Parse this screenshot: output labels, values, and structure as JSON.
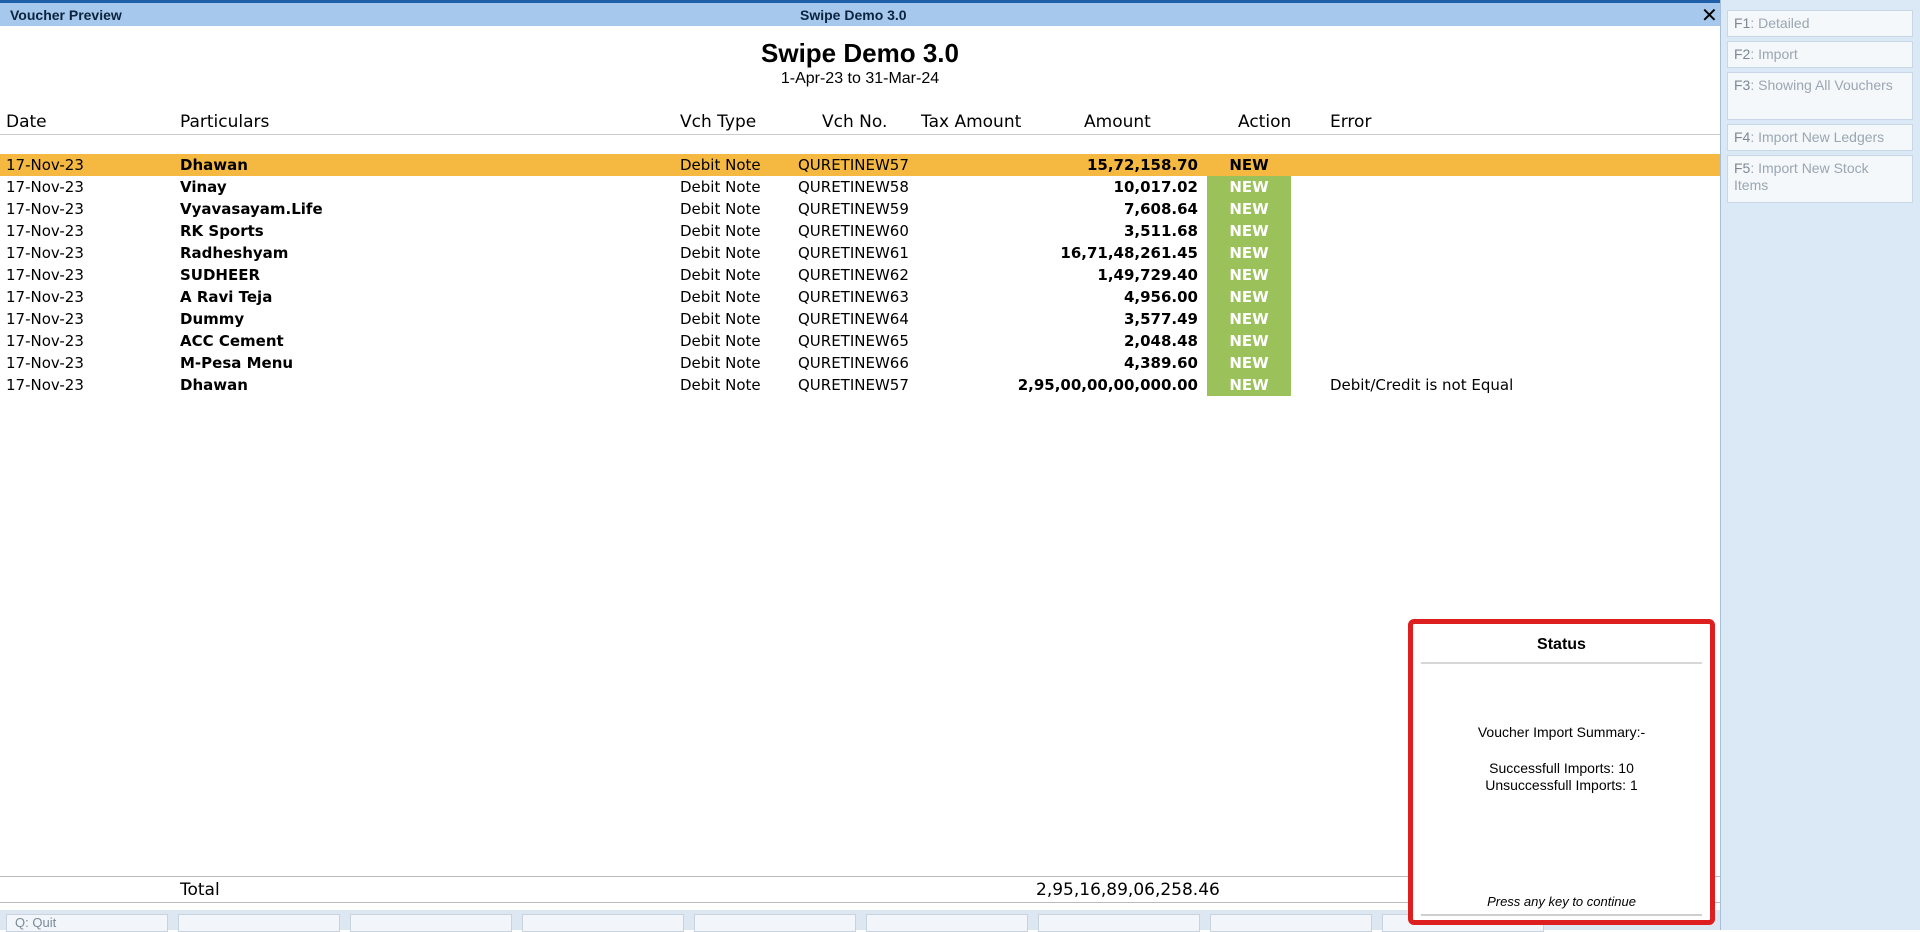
{
  "topbar": {
    "window_title": "Voucher Preview",
    "center_title": "Swipe Demo 3.0",
    "close": "✕"
  },
  "header": {
    "company": "Swipe Demo 3.0",
    "period": "1-Apr-23 to 31-Mar-24"
  },
  "columns": {
    "date": "Date",
    "particulars": "Particulars",
    "vch_type": "Vch Type",
    "vch_no": "Vch No.",
    "tax_amount": "Tax Amount",
    "amount": "Amount",
    "action": "Action",
    "error": "Error"
  },
  "rows": [
    {
      "date": "17-Nov-23",
      "particulars": "Dhawan",
      "vch_type": "Debit Note",
      "vch_no": "QURETINEW57",
      "amount": "15,72,158.70",
      "action": "NEW",
      "error": ""
    },
    {
      "date": "17-Nov-23",
      "particulars": "Vinay",
      "vch_type": "Debit Note",
      "vch_no": "QURETINEW58",
      "amount": "10,017.02",
      "action": "NEW",
      "error": ""
    },
    {
      "date": "17-Nov-23",
      "particulars": "Vyavasayam.Life",
      "vch_type": "Debit Note",
      "vch_no": "QURETINEW59",
      "amount": "7,608.64",
      "action": "NEW",
      "error": ""
    },
    {
      "date": "17-Nov-23",
      "particulars": "RK Sports",
      "vch_type": "Debit Note",
      "vch_no": "QURETINEW60",
      "amount": "3,511.68",
      "action": "NEW",
      "error": ""
    },
    {
      "date": "17-Nov-23",
      "particulars": "Radheshyam",
      "vch_type": "Debit Note",
      "vch_no": "QURETINEW61",
      "amount": "16,71,48,261.45",
      "action": "NEW",
      "error": ""
    },
    {
      "date": "17-Nov-23",
      "particulars": "SUDHEER",
      "vch_type": "Debit Note",
      "vch_no": "QURETINEW62",
      "amount": "1,49,729.40",
      "action": "NEW",
      "error": ""
    },
    {
      "date": "17-Nov-23",
      "particulars": "A Ravi Teja",
      "vch_type": "Debit Note",
      "vch_no": "QURETINEW63",
      "amount": "4,956.00",
      "action": "NEW",
      "error": ""
    },
    {
      "date": "17-Nov-23",
      "particulars": "Dummy",
      "vch_type": "Debit Note",
      "vch_no": "QURETINEW64",
      "amount": "3,577.49",
      "action": "NEW",
      "error": ""
    },
    {
      "date": "17-Nov-23",
      "particulars": "ACC Cement",
      "vch_type": "Debit Note",
      "vch_no": "QURETINEW65",
      "amount": "2,048.48",
      "action": "NEW",
      "error": ""
    },
    {
      "date": "17-Nov-23",
      "particulars": "M-Pesa Menu",
      "vch_type": "Debit Note",
      "vch_no": "QURETINEW66",
      "amount": "4,389.60",
      "action": "NEW",
      "error": ""
    },
    {
      "date": "17-Nov-23",
      "particulars": "Dhawan",
      "vch_type": "Debit Note",
      "vch_no": "QURETINEW57",
      "amount": "2,95,00,00,00,000.00",
      "action": "NEW",
      "error": "Debit/Credit is not Equal"
    }
  ],
  "total": {
    "label": "Total",
    "value": "2,95,16,89,06,258.46"
  },
  "bottombar": {
    "quit_key": "Q",
    "quit_label": ": Quit"
  },
  "right_panel": [
    {
      "key": "F1",
      "label": ": Detailed"
    },
    {
      "key": "F2",
      "label": ": Import"
    },
    {
      "key": "F3",
      "label": ": Showing All Vouchers"
    },
    {
      "key": "F4",
      "label": ": Import New Ledgers"
    },
    {
      "key": "F5",
      "label": ": Import New Stock Items"
    }
  ],
  "status": {
    "title": "Status",
    "summary": "Voucher Import Summary:-",
    "success": "Successfull Imports: 10",
    "failure": "Unsuccessfull Imports: 1",
    "press": "Press any key to continue"
  }
}
